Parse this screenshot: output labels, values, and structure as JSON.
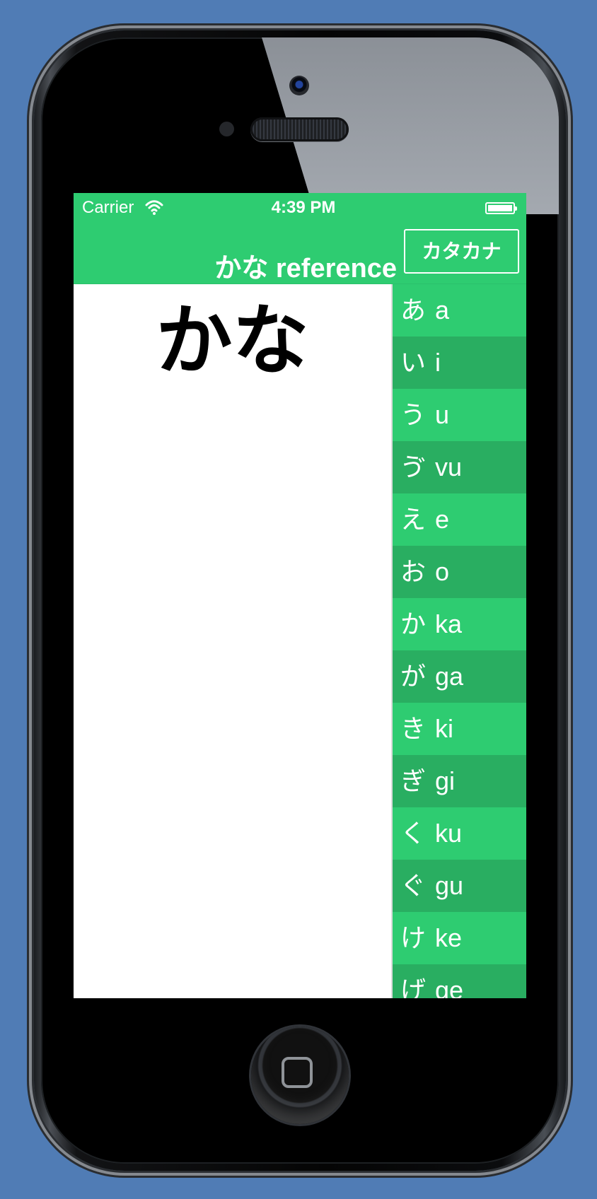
{
  "status_bar": {
    "carrier": "Carrier",
    "time": "4:39 PM",
    "wifi_icon": "wifi-icon",
    "battery_icon": "battery-icon"
  },
  "nav_bar": {
    "title": "かな reference",
    "script_button_label": "カタカナ"
  },
  "detail": {
    "title": "かな"
  },
  "kana_list": {
    "items": [
      {
        "kana": "あ",
        "romaji": "a"
      },
      {
        "kana": "い",
        "romaji": "i"
      },
      {
        "kana": "う",
        "romaji": "u"
      },
      {
        "kana": "ゔ",
        "romaji": "vu"
      },
      {
        "kana": "え",
        "romaji": "e"
      },
      {
        "kana": "お",
        "romaji": "o"
      },
      {
        "kana": "か",
        "romaji": "ka"
      },
      {
        "kana": "が",
        "romaji": "ga"
      },
      {
        "kana": "き",
        "romaji": "ki"
      },
      {
        "kana": "ぎ",
        "romaji": "gi"
      },
      {
        "kana": "く",
        "romaji": "ku"
      },
      {
        "kana": "ぐ",
        "romaji": "gu"
      },
      {
        "kana": "け",
        "romaji": "ke"
      },
      {
        "kana": "げ",
        "romaji": "ge"
      }
    ]
  },
  "colors": {
    "background": "#507cb5",
    "accent": "#2ecc71",
    "accent_dark": "#29ae61",
    "text_on_accent": "#ffffff"
  }
}
